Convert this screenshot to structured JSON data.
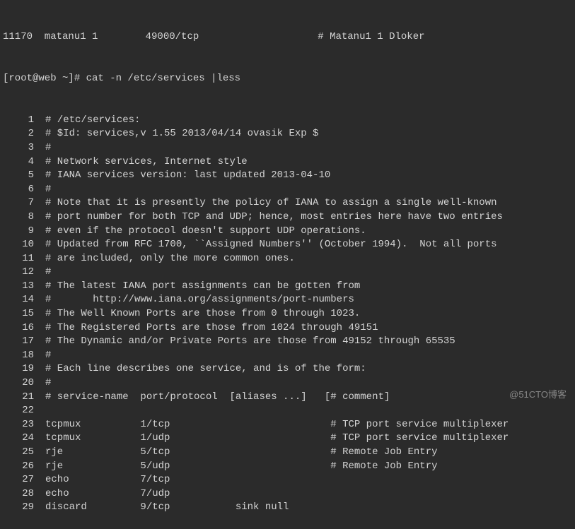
{
  "topLine": "11170  matanu1 1        49000/tcp                    # Matanu1 1 Dloker",
  "prompt": "[root@web ~]# cat -n /etc/services |less",
  "lines": [
    {
      "n": "1",
      "text": "# /etc/services:"
    },
    {
      "n": "2",
      "text": "# $Id: services,v 1.55 2013/04/14 ovasik Exp $"
    },
    {
      "n": "3",
      "text": "#"
    },
    {
      "n": "4",
      "text": "# Network services, Internet style"
    },
    {
      "n": "5",
      "text": "# IANA services version: last updated 2013-04-10"
    },
    {
      "n": "6",
      "text": "#"
    },
    {
      "n": "7",
      "text": "# Note that it is presently the policy of IANA to assign a single well-known"
    },
    {
      "n": "8",
      "text": "# port number for both TCP and UDP; hence, most entries here have two entries"
    },
    {
      "n": "9",
      "text": "# even if the protocol doesn't support UDP operations."
    },
    {
      "n": "10",
      "text": "# Updated from RFC 1700, ``Assigned Numbers'' (October 1994).  Not all ports"
    },
    {
      "n": "11",
      "text": "# are included, only the more common ones."
    },
    {
      "n": "12",
      "text": "#"
    },
    {
      "n": "13",
      "text": "# The latest IANA port assignments can be gotten from"
    },
    {
      "n": "14",
      "text": "#       http://www.iana.org/assignments/port-numbers"
    },
    {
      "n": "15",
      "text": "# The Well Known Ports are those from 0 through 1023."
    },
    {
      "n": "16",
      "text": "# The Registered Ports are those from 1024 through 49151"
    },
    {
      "n": "17",
      "text": "# The Dynamic and/or Private Ports are those from 49152 through 65535"
    },
    {
      "n": "18",
      "text": "#"
    },
    {
      "n": "19",
      "text": "# Each line describes one service, and is of the form:"
    },
    {
      "n": "20",
      "text": "#"
    },
    {
      "n": "21",
      "text": "# service-name  port/protocol  [aliases ...]   [# comment]"
    },
    {
      "n": "22",
      "text": ""
    },
    {
      "n": "23",
      "text": "tcpmux          1/tcp                           # TCP port service multiplexer"
    },
    {
      "n": "24",
      "text": "tcpmux          1/udp                           # TCP port service multiplexer"
    },
    {
      "n": "25",
      "text": "rje             5/tcp                           # Remote Job Entry"
    },
    {
      "n": "26",
      "text": "rje             5/udp                           # Remote Job Entry"
    },
    {
      "n": "27",
      "text": "echo            7/tcp"
    },
    {
      "n": "28",
      "text": "echo            7/udp"
    },
    {
      "n": "29",
      "text": "discard         9/tcp           sink null"
    }
  ],
  "watermark": "@51CTO博客"
}
